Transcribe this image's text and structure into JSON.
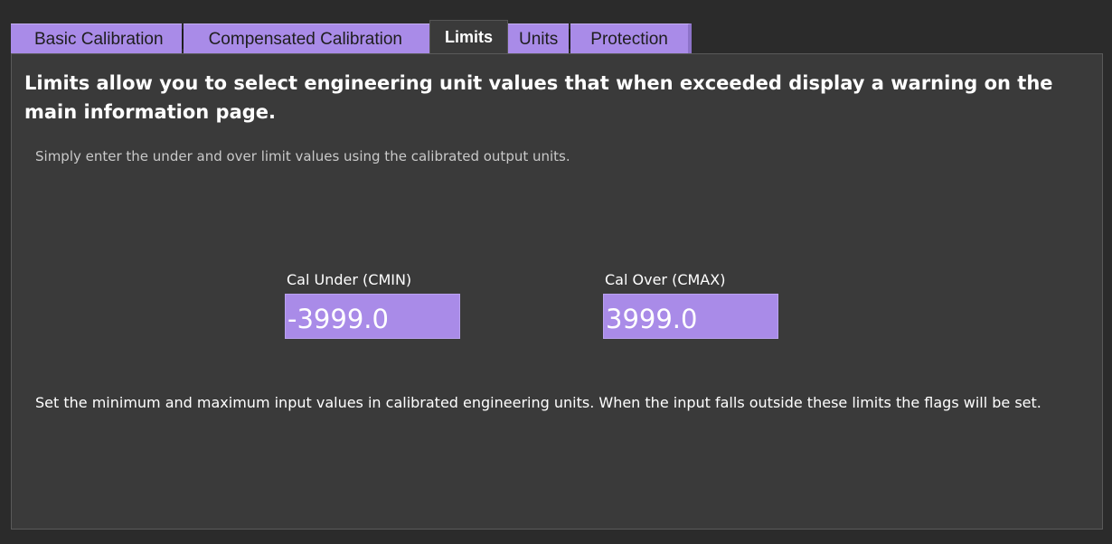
{
  "tabs": [
    {
      "label": "Basic Calibration"
    },
    {
      "label": "Compensated Calibration"
    },
    {
      "label": "Limits"
    },
    {
      "label": "Units"
    },
    {
      "label": "Protection"
    }
  ],
  "active_tab": "Limits",
  "page": {
    "heading": "Limits allow you to select engineering unit values that when exceeded display a warning on the main information page.",
    "subheading": "Simply enter the under and over limit values using the calibrated output units.",
    "note": "Set the minimum and maximum input values in calibrated engineering units. When the input falls outside these limits the flags will be set."
  },
  "fields": {
    "cal_under": {
      "label": "Cal Under (CMIN)",
      "value": "-3999.0"
    },
    "cal_over": {
      "label": "Cal Over (CMAX)",
      "value": "3999.0"
    }
  },
  "colors": {
    "accent": "#a98be8",
    "background": "#2b2b2b",
    "panel": "#3a3a3a"
  }
}
